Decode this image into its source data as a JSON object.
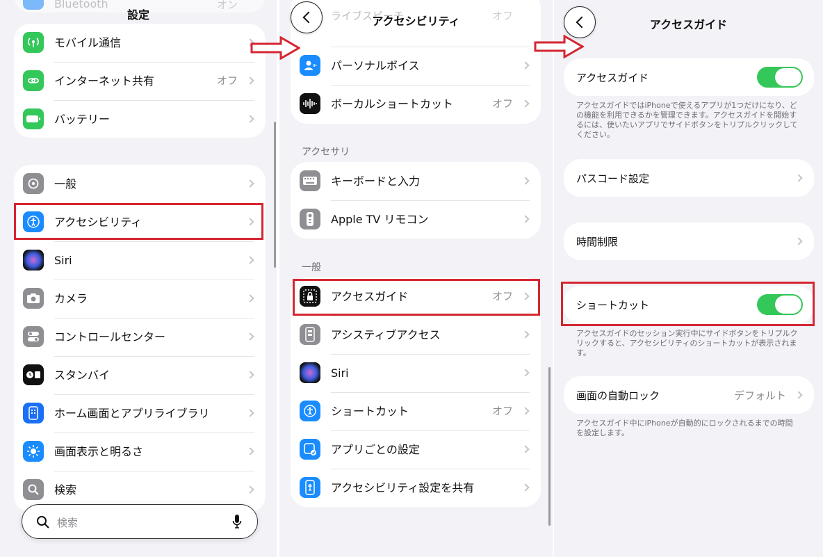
{
  "panel1": {
    "title": "設定",
    "top_partial": {
      "label": "Bluetooth",
      "value": "オン"
    },
    "group1": [
      {
        "label": "モバイル通信",
        "value": "",
        "icon": "antenna-icon",
        "color": "#34c759"
      },
      {
        "label": "インターネット共有",
        "value": "オフ",
        "icon": "link-icon",
        "color": "#34c759"
      },
      {
        "label": "バッテリー",
        "value": "",
        "icon": "battery-icon",
        "color": "#34c759"
      }
    ],
    "group2": [
      {
        "label": "一般",
        "icon": "gear-icon",
        "color": "#8e8e93"
      },
      {
        "label": "アクセシビリティ",
        "icon": "accessibility-icon",
        "color": "#1a8cff"
      },
      {
        "label": "Siri",
        "icon": "siri-icon",
        "color": "#222"
      },
      {
        "label": "カメラ",
        "icon": "camera-icon",
        "color": "#8e8e93"
      },
      {
        "label": "コントロールセンター",
        "icon": "toggles-icon",
        "color": "#8e8e93"
      },
      {
        "label": "スタンバイ",
        "icon": "standby-icon",
        "color": "#111"
      },
      {
        "label": "ホーム画面とアプリライブラリ",
        "icon": "home-screen-icon",
        "color": "#1a6ff5"
      },
      {
        "label": "画面表示と明るさ",
        "icon": "sun-icon",
        "color": "#1a8cff"
      },
      {
        "label": "検索",
        "icon": "search-icon",
        "color": "#8e8e93"
      }
    ],
    "search_placeholder": "検索"
  },
  "panel2": {
    "title": "アクセシビリティ",
    "top_partial": {
      "label": "ライブスピーチ",
      "value": "オフ"
    },
    "group1": [
      {
        "label": "パーソナルボイス",
        "value": "",
        "icon": "personal-voice-icon",
        "color": "#1a8cff"
      },
      {
        "label": "ボーカルショートカット",
        "value": "オフ",
        "icon": "waveform-icon",
        "color": "#111"
      }
    ],
    "section_accessories": "アクセサリ",
    "group2": [
      {
        "label": "キーボードと入力",
        "value": "",
        "icon": "keyboard-icon",
        "color": "#8e8e93"
      },
      {
        "label": "Apple TV リモコン",
        "value": "",
        "icon": "remote-icon",
        "color": "#8e8e93"
      }
    ],
    "section_general": "一般",
    "group3": [
      {
        "label": "アクセスガイド",
        "value": "オフ",
        "icon": "lock-icon",
        "color": "#111"
      },
      {
        "label": "アシスティブアクセス",
        "value": "",
        "icon": "assistive-access-icon",
        "color": "#8e8e93"
      },
      {
        "label": "Siri",
        "value": "",
        "icon": "siri-icon",
        "color": "#222"
      },
      {
        "label": "ショートカット",
        "value": "オフ",
        "icon": "accessibility-icon",
        "color": "#1a8cff"
      },
      {
        "label": "アプリごとの設定",
        "value": "",
        "icon": "per-app-icon",
        "color": "#1a8cff"
      },
      {
        "label": "アクセシビリティ設定を共有",
        "value": "",
        "icon": "share-settings-icon",
        "color": "#1a8cff"
      }
    ]
  },
  "panel3": {
    "title": "アクセスガイド",
    "guided_access_label": "アクセスガイド",
    "guided_access_on": true,
    "footnote1": "アクセスガイドではiPhoneで使えるアプリが1つだけになり、どの機能を利用できるかを管理できます。アクセスガイドを開始するには、使いたいアプリでサイドボタンをトリプルクリックしてください。",
    "passcode_label": "パスコード設定",
    "time_limits_label": "時間制限",
    "shortcut_label": "ショートカット",
    "shortcut_on": true,
    "footnote2": "アクセスガイドのセッション実行中にサイドボタンをトリプルクリックすると、アクセシビリティのショートカットが表示されます。",
    "autolock_label": "画面の自動ロック",
    "autolock_value": "デフォルト",
    "footnote3": "アクセスガイド中にiPhoneが自動的にロックされるまでの時間を設定します。"
  },
  "colors": {
    "highlight": "#d52631",
    "toggle_on": "#34c759",
    "background": "#f2f2f7"
  }
}
